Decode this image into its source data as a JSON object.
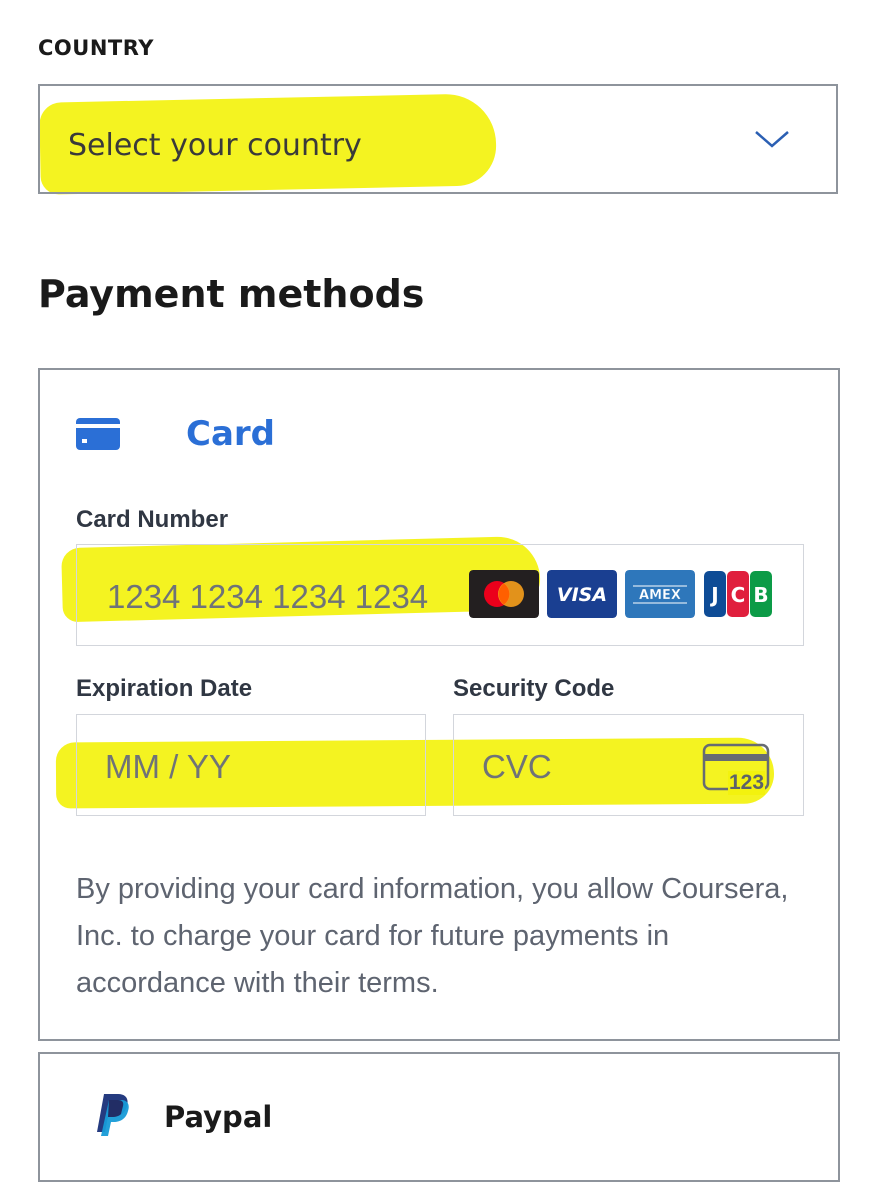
{
  "country": {
    "label": "COUNTRY",
    "select_placeholder": "Select your country",
    "chevron_icon": "chevron-down-icon"
  },
  "payment": {
    "title": "Payment methods",
    "card": {
      "title": "Card",
      "icon": "credit-card-icon",
      "card_number_label": "Card Number",
      "card_number_placeholder": "1234 1234 1234 1234",
      "brands": [
        "mastercard",
        "VISA",
        "AMEX",
        "JCB"
      ],
      "expiration_label": "Expiration Date",
      "expiration_placeholder": "MM / YY",
      "security_label": "Security Code",
      "security_placeholder": "CVC",
      "cvc_icon_text": "123",
      "terms": "By providing your card information, you allow Coursera, Inc. to charge your card for future payments in accordance with their terms."
    },
    "paypal": {
      "label": "Paypal",
      "icon": "paypal-icon"
    }
  },
  "colors": {
    "accent": "#2b6fd6",
    "highlight": "#f3f20e",
    "border": "#8e949c"
  }
}
